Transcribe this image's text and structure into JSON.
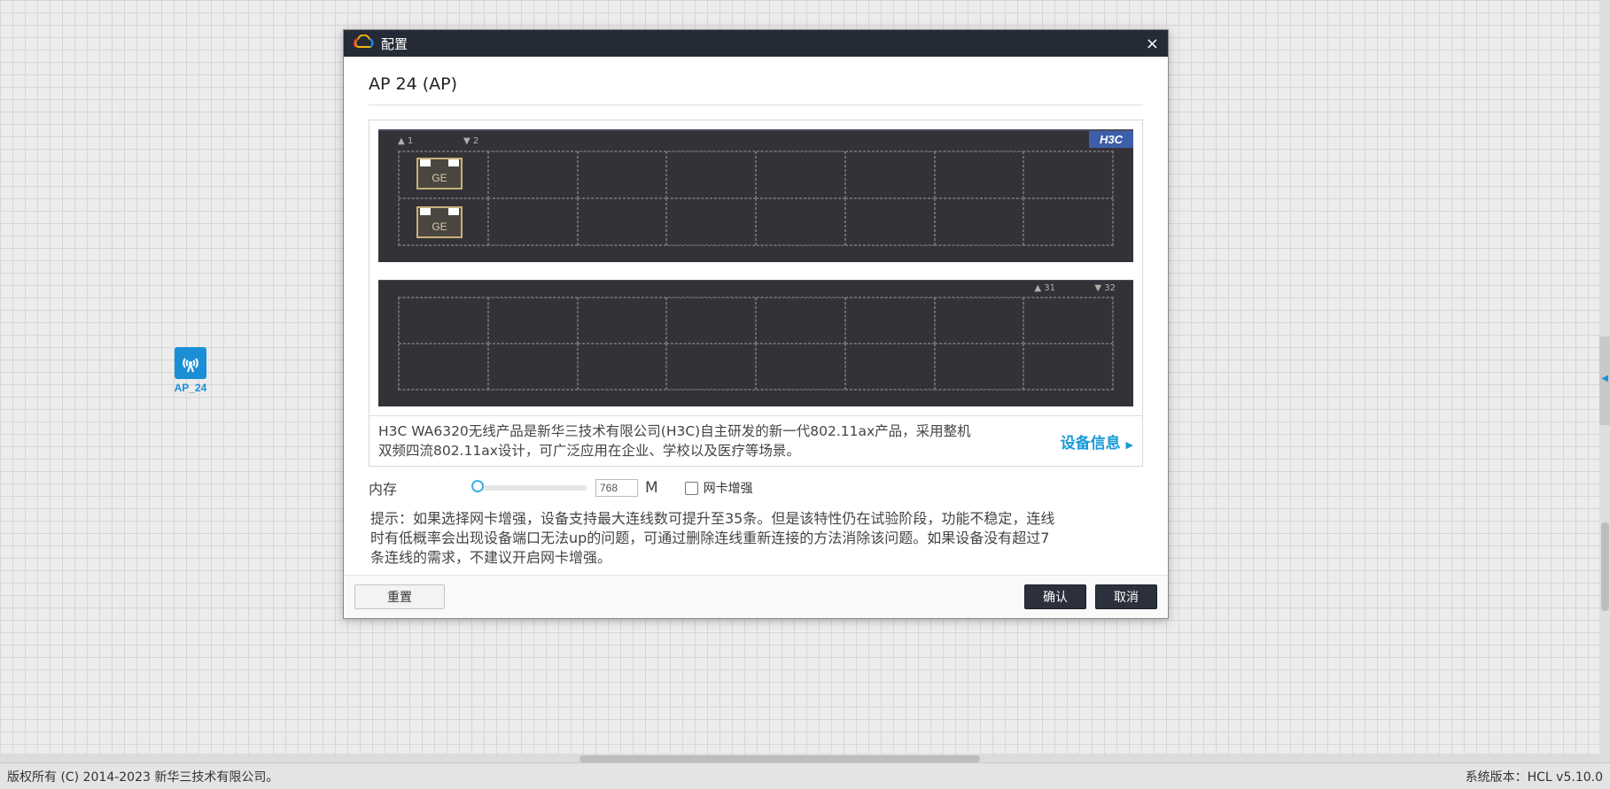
{
  "canvas": {
    "device_label": "AP_24"
  },
  "dialog": {
    "title": "配置",
    "close": "×",
    "device_heading": "AP  24 (AP)",
    "logo_text": "H3C",
    "port_markers": {
      "top_a": "1",
      "top_b": "2",
      "bottom_a": "31",
      "bottom_b": "32"
    },
    "ports": [
      "GE",
      "GE"
    ],
    "description_line1": "H3C WA6320无线产品是新华三技术有限公司(H3C)自主研发的新一代802.11ax产品，采用整机",
    "description_line2": "双频四流802.11ax设计，可广泛应用在企业、学校以及医疗等场景。",
    "device_info_link": "设备信息",
    "memory_label": "内存",
    "memory_value": "768",
    "memory_unit": "M",
    "memory_slider_fraction": 0.0,
    "nic_enhance_label": "网卡增强",
    "nic_enhance_checked": false,
    "hint_line1": "提示：如果选择网卡增强，设备支持最大连线数可提升至35条。但是该特性仍在试验阶段，功能不稳定，连线",
    "hint_line2": "时有低概率会出现设备端口无法up的问题，可通过删除连线重新连接的方法消除该问题。如果设备没有超过7",
    "hint_line3": "条连线的需求，不建议开启网卡增强。",
    "buttons": {
      "reset": "重置",
      "ok": "确认",
      "cancel": "取消"
    }
  },
  "statusbar": {
    "copyright": "版权所有 (C) 2014-2023 新华三技术有限公司。",
    "version": "系统版本：HCL v5.10.0"
  },
  "colors": {
    "accent": "#1a9ad8",
    "titlebar": "#252b36",
    "chassis": "#353237"
  },
  "icons": {
    "app": "cloud-logo-icon",
    "device": "wireless-ap-icon"
  }
}
